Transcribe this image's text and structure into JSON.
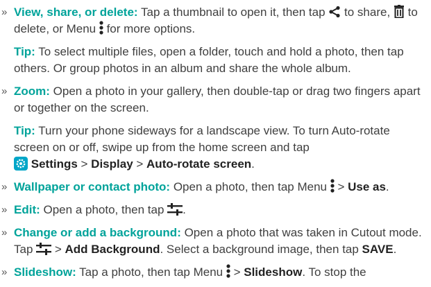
{
  "bullet": "»",
  "view": {
    "title": "View, share, or delete:",
    "t1": " Tap a thumbnail to open it, then tap ",
    "t2": " to share, ",
    "t3": " to delete, or Menu ",
    "t4": " for more options.",
    "icons": [
      "share-icon",
      "trash-icon",
      "menu-dots-icon"
    ]
  },
  "tip1": {
    "label": "Tip:",
    "text": " To select multiple files, open a folder, touch and hold a photo, then tap others. Or group photos in an album and share the whole album."
  },
  "zoom": {
    "title": "Zoom:",
    "text": " Open a photo in your gallery, then double-tap or drag two fingers apart or together on the screen."
  },
  "tip2": {
    "label": "Tip:",
    "text": " Turn your phone sideways for a landscape view. To turn Auto-rotate screen on or off, swipe up from the home screen and tap ",
    "settings": "Settings",
    "sep1": " > ",
    "display": "Display",
    "sep2": " > ",
    "autorotate": "Auto-rotate screen",
    "end": "."
  },
  "wallpaper": {
    "title": "Wallpaper or contact photo:",
    "t1": " Open a photo, then tap Menu ",
    "sep": " > ",
    "useas": "Use as",
    "end": "."
  },
  "edit": {
    "title": "Edit:",
    "t1": " Open a photo, then tap ",
    "end": "."
  },
  "background": {
    "title": "Change or add a background:",
    "t1": " Open a photo that was taken in Cutout mode. Tap ",
    "sep": " > ",
    "addbg": "Add Background",
    "t2": ". Select a background image, then tap ",
    "save": "SAVE",
    "end": "."
  },
  "slideshow": {
    "title": "Slideshow:",
    "t1": " Tap a photo, then tap Menu ",
    "sep": " > ",
    "label": "Slideshow",
    "t2": ". To stop the"
  },
  "colors": {
    "accent": "#00a39a",
    "text": "#3f3f3f",
    "settings_badge": "#00a6c8"
  }
}
